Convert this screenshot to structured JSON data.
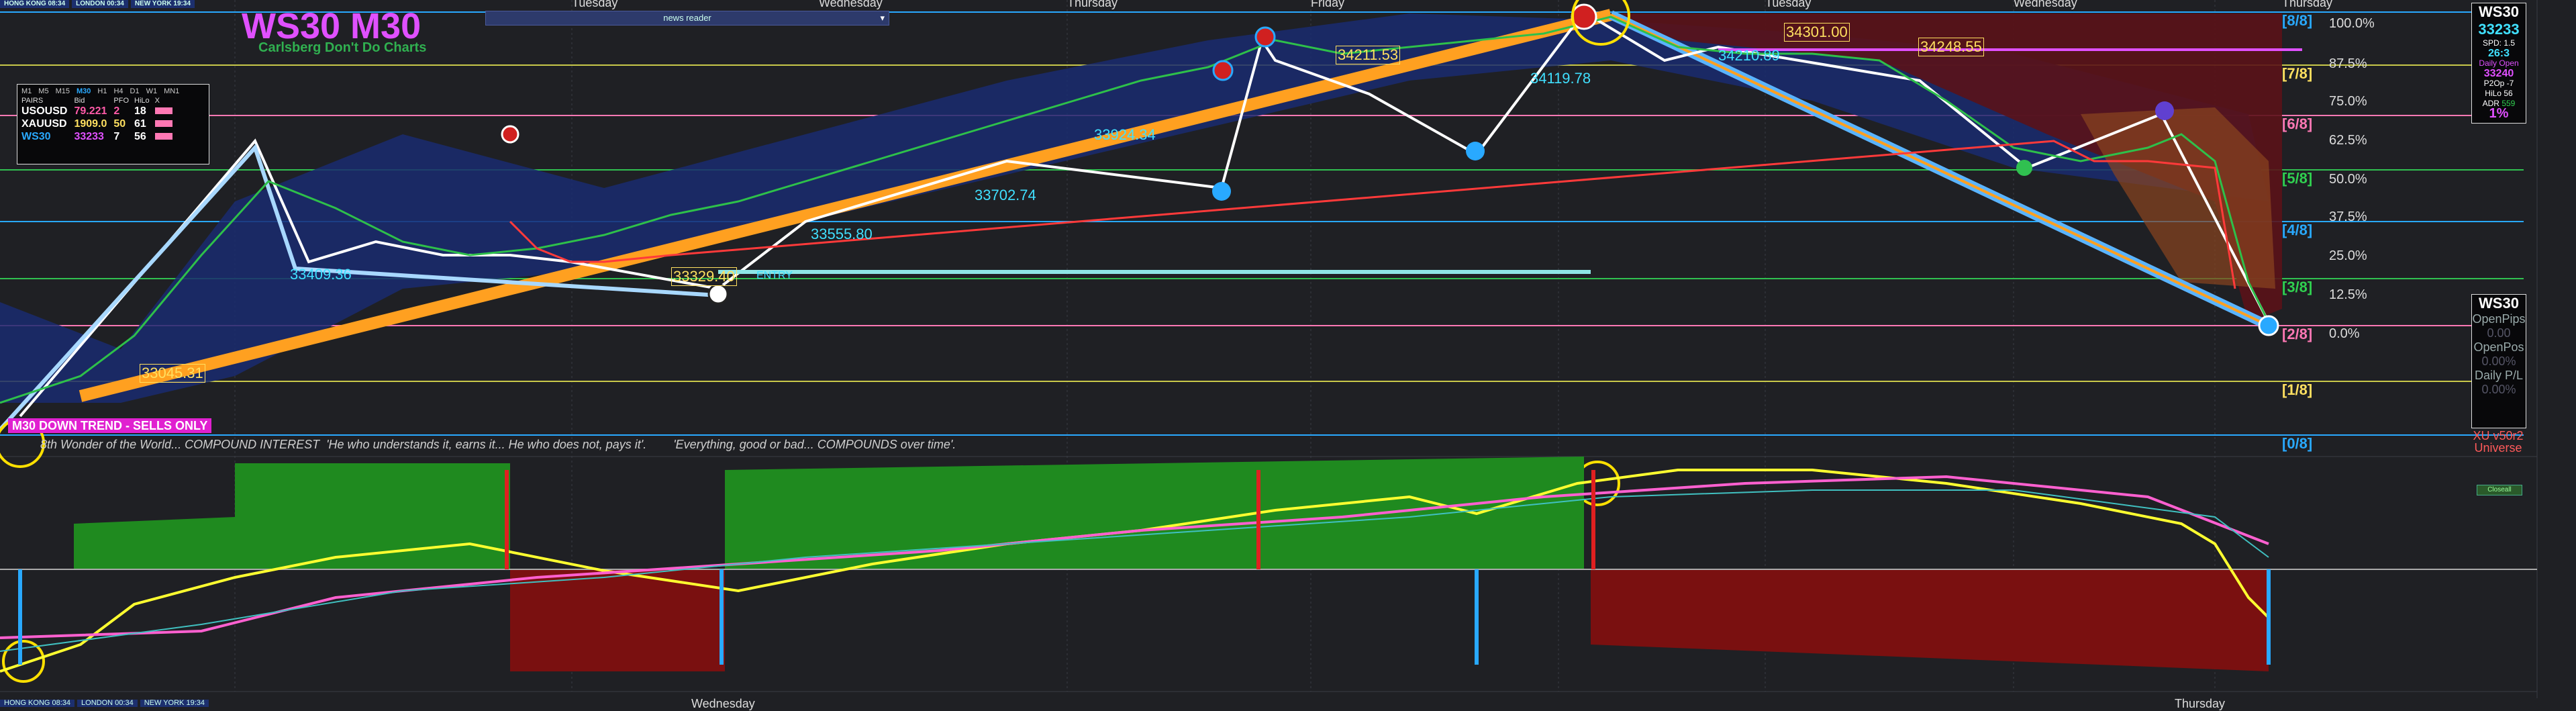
{
  "sessions": {
    "hongkong": "HONG KONG 08:34",
    "london": "LONDON 00:34",
    "newyork": "NEW YORK 19:34"
  },
  "title": "WS30 M30",
  "subtitle": "Carlsberg Don't Do Charts",
  "news_label": "news reader",
  "pairs_panel": {
    "timeframes": [
      "M1",
      "M5",
      "M15",
      "M30",
      "H1",
      "H4",
      "D1",
      "W1",
      "MN1"
    ],
    "active_tf": "M30",
    "headers": [
      "PAIRS",
      "Bid",
      "PFO",
      "HiLo",
      "X"
    ],
    "rows": [
      {
        "pair": "USOUSD",
        "bid": "79.221",
        "pfo": "2",
        "hilo": "18",
        "color": "#ffffff",
        "bidcolor": "#ff5aa8"
      },
      {
        "pair": "XAUUSD",
        "bid": "1909.0",
        "pfo": "50",
        "hilo": "61",
        "color": "#ffffff",
        "bidcolor": "#ffe060"
      },
      {
        "pair": "WS30",
        "bid": "33233",
        "pfo": "7",
        "hilo": "56",
        "color": "#29a9ff",
        "bidcolor": "#e050ff"
      }
    ]
  },
  "info_box": {
    "symbol": "WS30",
    "price": "33233",
    "spd": "SPD: 1.5",
    "spread_val": "26:3",
    "daily_open_label": "Daily Open",
    "daily_open": "33240",
    "p2op": "P2Op",
    "p2op_val": "-7",
    "hilo": "HiLo",
    "hilo_val": "56",
    "adr": "ADR",
    "adr_val": "559",
    "pct": "1%"
  },
  "position_box": {
    "symbol": "WS30",
    "openpips_label": "OpenPips",
    "openpips": "0.00",
    "openpos_label": "OpenPos",
    "openpos": "0.00%",
    "dailypl_label": "Daily P/L",
    "dailypl": "0.00%"
  },
  "brand": {
    "line1": "XU v50r2",
    "line2": "Universe"
  },
  "downtrend": "M30 DOWN TREND - SELLS ONLY",
  "quote": "8th Wonder of the World... COMPOUND INTEREST  'He who understands it, earns it... He who does not, pays it'.        'Everything, good or bad... COMPOUNDS over time'.",
  "days_top": [
    "Tuesday",
    "Wednesday",
    "Thursday",
    "Friday",
    "Tuesday",
    "Wednesday",
    "Thursday"
  ],
  "days_bottom": [
    "Wednesday",
    "Thursday"
  ],
  "levels": [
    {
      "label": "[8/8]",
      "pct": "100.0%",
      "color": "#29a9ff"
    },
    {
      "label": "[7/8]",
      "pct": "87.5%",
      "color": "#ffe060"
    },
    {
      "label": "[6/8]",
      "pct": "75.0%",
      "color": "#ff78b4"
    },
    {
      "label": "[5/8]",
      "pct": "62.5%",
      "color": "#30d050"
    },
    {
      "label": "[4/8]",
      "pct": "50.0%",
      "color": "#29a9ff"
    },
    {
      "label": "[3/8]",
      "pct": "37.5%",
      "color": "#30d050"
    },
    {
      "label": "[2/8]",
      "pct": "25.0%",
      "color": "#ff78b4"
    },
    {
      "label": "[1/8]",
      "pct": "12.5%",
      "color": "#ffe060"
    },
    {
      "label": "[0/8]",
      "pct": "0.0%",
      "color": "#29a9ff"
    }
  ],
  "price_labels": [
    "34211.53",
    "34119.78",
    "34210.89",
    "34301.00",
    "34248.55",
    "33924.34",
    "33702.74",
    "33555.80",
    "33409.36",
    "33329.40",
    "33045.31"
  ],
  "entry_label": "ENTRY",
  "close_toggle": "Closeall",
  "colors": {
    "bg": "#1f2024",
    "bull": "#1f8a1f",
    "bear": "#7a1010",
    "band": "#1a2c70",
    "orange": "#ffa020",
    "sky": "#5ab4ff"
  }
}
